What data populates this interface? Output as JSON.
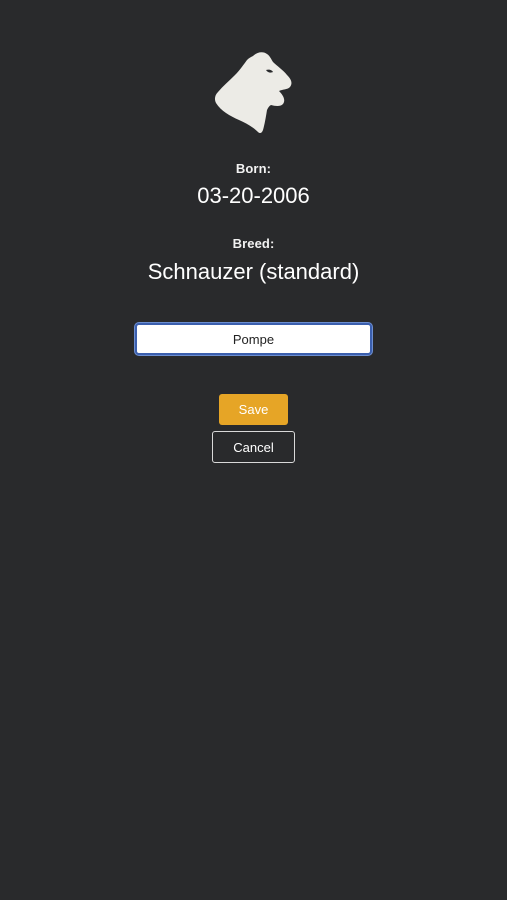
{
  "profile": {
    "avatar_icon": "schnauzer-head-icon",
    "born_label": "Born:",
    "born_value": "03-20-2006",
    "breed_label": "Breed:",
    "breed_value": "Schnauzer (standard)"
  },
  "form": {
    "name_value": "Pompe",
    "save_label": "Save",
    "cancel_label": "Cancel"
  },
  "colors": {
    "background": "#292a2c",
    "accent": "#e6a526",
    "input_focus": "#3b5fae"
  }
}
